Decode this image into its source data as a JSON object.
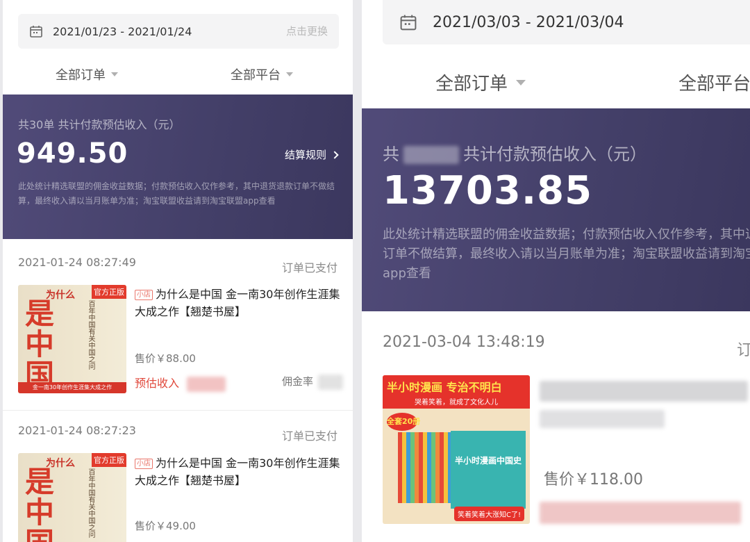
{
  "left": {
    "date_range": "2021/01/23 - 2021/01/24",
    "change_label": "点击更换",
    "filter_orders": "全部订单",
    "filter_platform": "全部平台",
    "summary_caption": "共30单 共计付款预估收入（元）",
    "amount": "949.50",
    "rules_label": "结算规则",
    "note": "此处统计精选联盟的佣金收益数据；付款预估收入仅作参考，其中退货退款订单不做结算，最终收入请以当月账单为准；淘宝联盟收益请到淘宝联盟app查看",
    "orders": [
      {
        "time": "2021-01-24 08:27:49",
        "status": "订单已支付",
        "tag": "小店",
        "title": "为什么是中国 金一南30年创作生涯集大成之作【翘楚书屋】",
        "price": "售价￥88.00",
        "est_label": "预估收入",
        "commission_label": "佣金率",
        "cover": {
          "badge": "官方正版",
          "big_chars": "是中国",
          "top_chars": "为什么",
          "vertical_text": "百年中国有关中国之问",
          "strip": "金一南30年创作生涯集大成之作"
        }
      },
      {
        "time": "2021-01-24 08:27:23",
        "status": "订单已支付",
        "tag": "小店",
        "title": "为什么是中国 金一南30年创作生涯集大成之作【翘楚书屋】",
        "price": "售价￥49.00",
        "cover": {
          "badge": "官方正版",
          "big_chars": "是中国",
          "top_chars": "为什么",
          "vertical_text": "百年中国有关中国之问"
        }
      }
    ]
  },
  "right": {
    "date_range": "2021/03/03 - 2021/03/04",
    "filter_orders": "全部订单",
    "filter_platform": "全部平台",
    "summary_prefix": "共",
    "summary_suffix": "共计付款预估收入（元）",
    "amount": "13703.85",
    "note": "此处统计精选联盟的佣金收益数据；付款预估收入仅作参考，其中退货退款订单不做结算，最终收入请以当月账单为准；淘宝联盟收益请到淘宝联盟app查看",
    "order": {
      "time": "2021-03-04 13:48:19",
      "status": "订",
      "price": "售价￥118.00",
      "cover": {
        "headline": "半小时漫画 专治不明白",
        "subline": "哭着笑着，就成了文化人儿",
        "count_badge": "全套20册",
        "front_title": "半小时漫画中国史",
        "sticker": "笑着笑着大涨知C了!"
      }
    }
  },
  "colors": {
    "summary_bg": "#4a4570",
    "accent_red": "#e0473a"
  }
}
